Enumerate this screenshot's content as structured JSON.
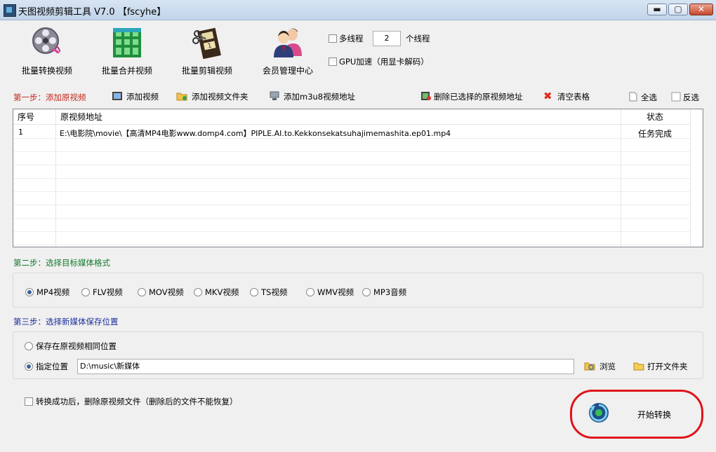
{
  "window": {
    "title": "天图视频剪辑工具 V7.0  【fscyhe】",
    "minimize_glyph": "▬",
    "maximize_glyph": "▢",
    "close_glyph": "✕"
  },
  "toolbar": {
    "batch_convert": "批量转换视频",
    "batch_merge": "批量合并视频",
    "batch_cut": "批量剪辑视频",
    "member_center": "会员管理中心"
  },
  "options": {
    "multithread_label": "多线程",
    "thread_count": "2",
    "thread_unit": "个线程",
    "gpu_label": "GPU加速（用显卡解码）"
  },
  "step1": {
    "title": "第一步：添加原视频",
    "add_video": "添加视频",
    "add_folder": "添加视频文件夹",
    "add_m3u8": "添加m3u8视频地址",
    "delete_selected": "删除已选择的原视频地址",
    "clear_table": "清空表格",
    "select_all": "全选",
    "invert_select": "反选"
  },
  "table": {
    "headers": [
      "序号",
      "原视频地址",
      "状态"
    ],
    "rows": [
      {
        "index": "1",
        "path": "E:\\电影院\\movie\\【高清MP4电影www.domp4.com】PIPLE.AI.to.Kekkonsekatsuhajimemashita.ep01.mp4",
        "status": "任务完成"
      }
    ]
  },
  "step2": {
    "title": "第二步：选择目标媒体格式",
    "formats": [
      "MP4视频",
      "FLV视频",
      "MOV视频",
      "MKV视频",
      "TS视频",
      "WMV视频",
      "MP3音频"
    ],
    "selected": "MP4视频"
  },
  "step3": {
    "title": "第三步：选择新媒体保存位置",
    "same_location": "保存在原视频相同位置",
    "custom_location": "指定位置",
    "path": "D:\\music\\新媒体",
    "browse": "浏览",
    "open_folder": "打开文件夹"
  },
  "footer": {
    "delete_after": "转换成功后，删除原视频文件（删除后的文件不能恢复）",
    "start": "开始转换"
  },
  "colors": {
    "step1": "#c4291e",
    "step2": "#137a2f",
    "step3": "#1b2d9a",
    "highlight": "#e0131a"
  }
}
